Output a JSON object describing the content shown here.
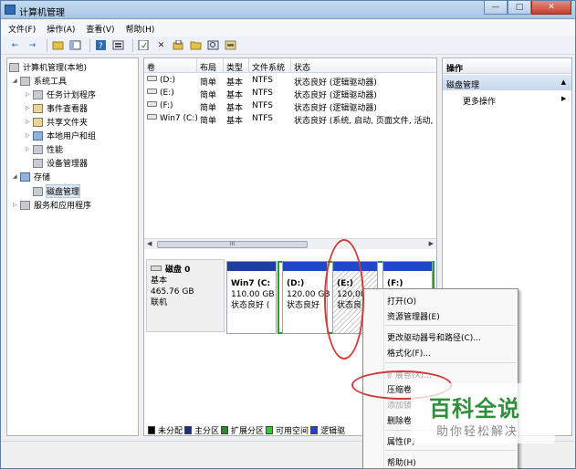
{
  "window": {
    "title": "计算机管理"
  },
  "caption_buttons": {
    "minimize": "—",
    "maximize": "□",
    "close": "✕"
  },
  "menu": [
    "文件(F)",
    "操作(A)",
    "查看(V)",
    "帮助(H)"
  ],
  "toolbar": {
    "back": "←",
    "forward": "→",
    "delete": "✕"
  },
  "tree": {
    "root": "计算机管理(本地)",
    "system_tools": "系统工具",
    "items": [
      "任务计划程序",
      "事件查看器",
      "共享文件夹",
      "本地用户和组",
      "性能",
      "设备管理器"
    ],
    "storage": "存储",
    "disk_management": "磁盘管理",
    "services": "服务和应用程序"
  },
  "volume_table": {
    "headers": [
      "卷",
      "布局",
      "类型",
      "文件系统",
      "状态"
    ],
    "rows": [
      {
        "vol": "(D:)",
        "layout": "简单",
        "type": "基本",
        "fs": "NTFS",
        "status": "状态良好 (逻辑驱动器)"
      },
      {
        "vol": "(E:)",
        "layout": "简单",
        "type": "基本",
        "fs": "NTFS",
        "status": "状态良好 (逻辑驱动器)"
      },
      {
        "vol": "(F:)",
        "layout": "简单",
        "type": "基本",
        "fs": "NTFS",
        "status": "状态良好 (逻辑驱动器)"
      },
      {
        "vol": "Win7 (C:)",
        "layout": "简单",
        "type": "基本",
        "fs": "NTFS",
        "status": "状态良好 (系统, 启动, 页面文件, 活动,"
      }
    ],
    "scroll_thumb": "III"
  },
  "disk": {
    "name": "磁盘 0",
    "type": "基本",
    "size": "465.76 GB",
    "status": "联机",
    "partitions": [
      {
        "name": "Win7  (C:",
        "size": "110.00 GB",
        "status": "状态良好 ("
      },
      {
        "name": "(D:)",
        "size": "120.00 GB",
        "status": "状态良好"
      },
      {
        "name": "(E:)",
        "size": "120.00",
        "status": "状态良"
      },
      {
        "name": "(F:)",
        "size": "",
        "status": ""
      }
    ]
  },
  "legend": [
    {
      "label": "未分配",
      "color": "#000000"
    },
    {
      "label": "主分区",
      "color": "#1a2f8c"
    },
    {
      "label": "扩展分区",
      "color": "#2a8a2a"
    },
    {
      "label": "可用空间",
      "color": "#33cc33"
    },
    {
      "label": "逻辑驱",
      "color": "#2244cc"
    }
  ],
  "actions": {
    "header": "操作",
    "section": "磁盘管理",
    "more": "更多操作"
  },
  "context_menu": {
    "items": [
      {
        "label": "打开(O)",
        "disabled": false
      },
      {
        "label": "资源管理器(E)",
        "disabled": false
      },
      {
        "label": "更改驱动器号和路径(C)...",
        "disabled": false
      },
      {
        "label": "格式化(F)...",
        "disabled": false
      },
      {
        "label": "扩展卷(X)...",
        "disabled": true
      },
      {
        "label": "压缩卷",
        "disabled": false
      },
      {
        "label": "添加镜",
        "disabled": true
      },
      {
        "label": "删除卷",
        "disabled": false
      },
      {
        "label": "属性(P)",
        "disabled": false
      },
      {
        "label": "帮助(H)",
        "disabled": false
      }
    ]
  },
  "watermark": {
    "main": "百科全说",
    "sub": "助你轻松解决"
  },
  "colors": {
    "annotation": "#d23a3a",
    "extended_frame": "#2a9a2a",
    "primary_bar": "#1f3fa0"
  }
}
